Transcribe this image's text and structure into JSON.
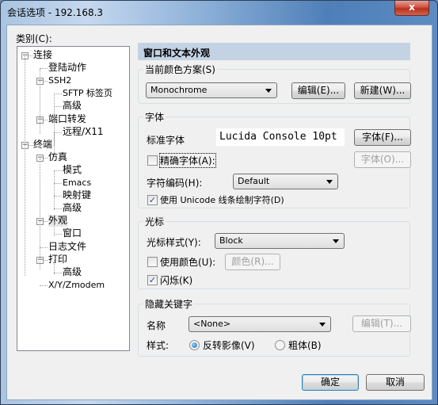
{
  "window": {
    "title": "会话选项 - 192.168.3",
    "close_label": "x"
  },
  "category_label": "类别(C):",
  "tree": [
    {
      "label": "连接",
      "level": 0,
      "expanded": true
    },
    {
      "label": "登陆动作",
      "level": 1
    },
    {
      "label": "SSH2",
      "level": 1,
      "expanded": true
    },
    {
      "label": "SFTP 标签页",
      "level": 2
    },
    {
      "label": "高级",
      "level": 2
    },
    {
      "label": "端口转发",
      "level": 1,
      "expanded": true
    },
    {
      "label": "远程/X11",
      "level": 2
    },
    {
      "label": "终端",
      "level": 0,
      "expanded": true
    },
    {
      "label": "仿真",
      "level": 1,
      "expanded": true
    },
    {
      "label": "模式",
      "level": 2
    },
    {
      "label": "Emacs",
      "level": 2
    },
    {
      "label": "映射键",
      "level": 2
    },
    {
      "label": "高级",
      "level": 2
    },
    {
      "label": "外观",
      "level": 1,
      "expanded": true,
      "selected": true
    },
    {
      "label": "窗口",
      "level": 2
    },
    {
      "label": "日志文件",
      "level": 1
    },
    {
      "label": "打印",
      "level": 1,
      "expanded": true
    },
    {
      "label": "高级",
      "level": 2
    },
    {
      "label": "X/Y/Zmodem",
      "level": 1
    }
  ],
  "panel": {
    "header": "窗口和文本外观",
    "color_scheme": {
      "title": "当前颜色方案(S)",
      "value": "Monochrome",
      "edit_button": "编辑(E)...",
      "new_button": "新建(W)..."
    },
    "font": {
      "title": "字体",
      "standard_font_label": "标准字体",
      "standard_font_value": "Lucida Console 10pt",
      "font_button": "字体(F)...",
      "precise_font_label": "精确字体(A):",
      "precise_font_checked": false,
      "precise_font_button": "字体(O)...",
      "encoding_label": "字符编码(H):",
      "encoding_value": "Default",
      "unicode_label": "使用 Unicode 线条绘制字符(D)",
      "unicode_checked": true
    },
    "cursor": {
      "title": "光标",
      "style_label": "光标样式(Y):",
      "style_value": "Block",
      "use_color_label": "使用颜色(U):",
      "use_color_checked": false,
      "color_button": "颜色(R)...",
      "blink_label": "闪烁(K)",
      "blink_checked": true
    },
    "keywords": {
      "title": "隐藏关键字",
      "name_label": "名称",
      "name_value": "<None>",
      "edit_button": "编辑(T)...",
      "style_label": "样式:",
      "reverse_label": "反转影像(V)",
      "reverse_checked": true,
      "bold_label": "粗体(B)",
      "bold_checked": false
    }
  },
  "footer": {
    "ok_button": "确定",
    "cancel_button": "取消"
  },
  "icons": {
    "checked": "✓",
    "expander": "−"
  }
}
